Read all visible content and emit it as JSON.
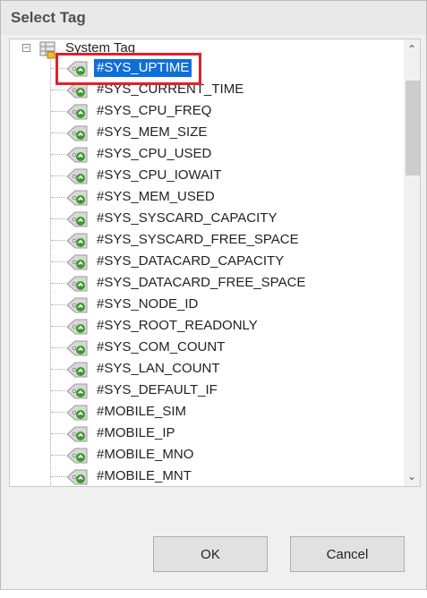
{
  "dialog": {
    "title": "Select Tag",
    "ok_label": "OK",
    "cancel_label": "Cancel"
  },
  "tree": {
    "root_label": "System Tag",
    "selected_item": "#SYS_UPTIME",
    "items": [
      {
        "label": "#SYS_UPTIME",
        "selected": true
      },
      {
        "label": "#SYS_CURRENT_TIME",
        "selected": false
      },
      {
        "label": "#SYS_CPU_FREQ",
        "selected": false
      },
      {
        "label": "#SYS_MEM_SIZE",
        "selected": false
      },
      {
        "label": "#SYS_CPU_USED",
        "selected": false
      },
      {
        "label": "#SYS_CPU_IOWAIT",
        "selected": false
      },
      {
        "label": "#SYS_MEM_USED",
        "selected": false
      },
      {
        "label": "#SYS_SYSCARD_CAPACITY",
        "selected": false
      },
      {
        "label": "#SYS_SYSCARD_FREE_SPACE",
        "selected": false
      },
      {
        "label": "#SYS_DATACARD_CAPACITY",
        "selected": false
      },
      {
        "label": "#SYS_DATACARD_FREE_SPACE",
        "selected": false
      },
      {
        "label": "#SYS_NODE_ID",
        "selected": false
      },
      {
        "label": "#SYS_ROOT_READONLY",
        "selected": false
      },
      {
        "label": "#SYS_COM_COUNT",
        "selected": false
      },
      {
        "label": "#SYS_LAN_COUNT",
        "selected": false
      },
      {
        "label": "#SYS_DEFAULT_IF",
        "selected": false
      },
      {
        "label": "#MOBILE_SIM",
        "selected": false
      },
      {
        "label": "#MOBILE_IP",
        "selected": false
      },
      {
        "label": "#MOBILE_MNO",
        "selected": false
      },
      {
        "label": "#MOBILE_MNT",
        "selected": false
      }
    ]
  },
  "icons": {
    "root": "database-tag-icon",
    "item": "tag-icon",
    "expander": "collapse-minus-icon",
    "scroll_up": "chevron-up-icon",
    "scroll_down": "chevron-down-icon"
  },
  "colors": {
    "selection": "#0f6fd8",
    "highlight_border": "#e0202a",
    "tag_icon_green": "#3a9a2a"
  }
}
